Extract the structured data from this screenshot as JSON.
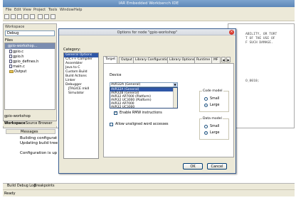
{
  "app": {
    "window_title": "IAR Embedded Workbench IDE",
    "menu": [
      "File",
      "Edit",
      "View",
      "Project",
      "Tools",
      "Window",
      "Help"
    ]
  },
  "workspace": {
    "title": "Workspace",
    "config": "Debug",
    "files_header": "Files",
    "tree": [
      "gpio-workshop...",
      "gpio.c",
      "gpio.h",
      "gpio_defines.h",
      "main.c",
      "Output"
    ],
    "bottom_label": "gpio-workshop",
    "tabs": [
      "Workspace",
      "Source Browser"
    ]
  },
  "editor": {
    "lines": [
      "ABILITY, OR TORT",
      "T OF THE USE OF",
      "F SUCH DAMAGE.",
      "O_0010;"
    ]
  },
  "messages": {
    "header": "Messages",
    "lines": [
      "Building configurat",
      "Updating build tree",
      "Configuration is up"
    ],
    "tabs": [
      "Build",
      "Debug Log",
      "Breakpoints"
    ]
  },
  "status": {
    "text": "Ready"
  },
  "dialog": {
    "title": "Options for node \"gpio-workshop\"",
    "category_label": "Category:",
    "categories": [
      "General Options",
      "C/C++ Compiler",
      "Assembler",
      "Java to C",
      "Custom Build",
      "Build Actions",
      "Linker",
      "Debugger",
      "JTAGICE mkII",
      "Simulator"
    ],
    "selected_category_index": 0,
    "tabs": [
      "Target",
      "Output",
      "Library Configuration",
      "Library Options",
      "Runtime",
      "MF"
    ],
    "active_tab_index": 0,
    "device_label": "Device",
    "device_value": "AVR32A (General)",
    "device_options": [
      "AVR32A (General)",
      "AVR32B (General)",
      "AVR32 AP7000 (Platform)",
      "AVR32 UC3000 (Platform)",
      "AVR32 AP7000",
      "AVR32 UC3000"
    ],
    "selected_option_index": 0,
    "enable_rmw_label": "Enable RMW instructions",
    "enable_rmw_checked": true,
    "unaligned_label": "Allow unaligned word accesses",
    "unaligned_checked": false,
    "code_model": {
      "title": "Code model",
      "options": [
        "Small",
        "Large"
      ],
      "selected": 1
    },
    "data_model": {
      "title": "Data model",
      "options": [
        "Small",
        "Large"
      ],
      "selected": 1
    },
    "ok_label": "OK",
    "cancel_label": "Cancel"
  },
  "colors": {
    "selection": "#2f57a7",
    "title_bar": "#6a90c0",
    "close_button": "#d93b2e",
    "chrome": "#ece9d8"
  }
}
